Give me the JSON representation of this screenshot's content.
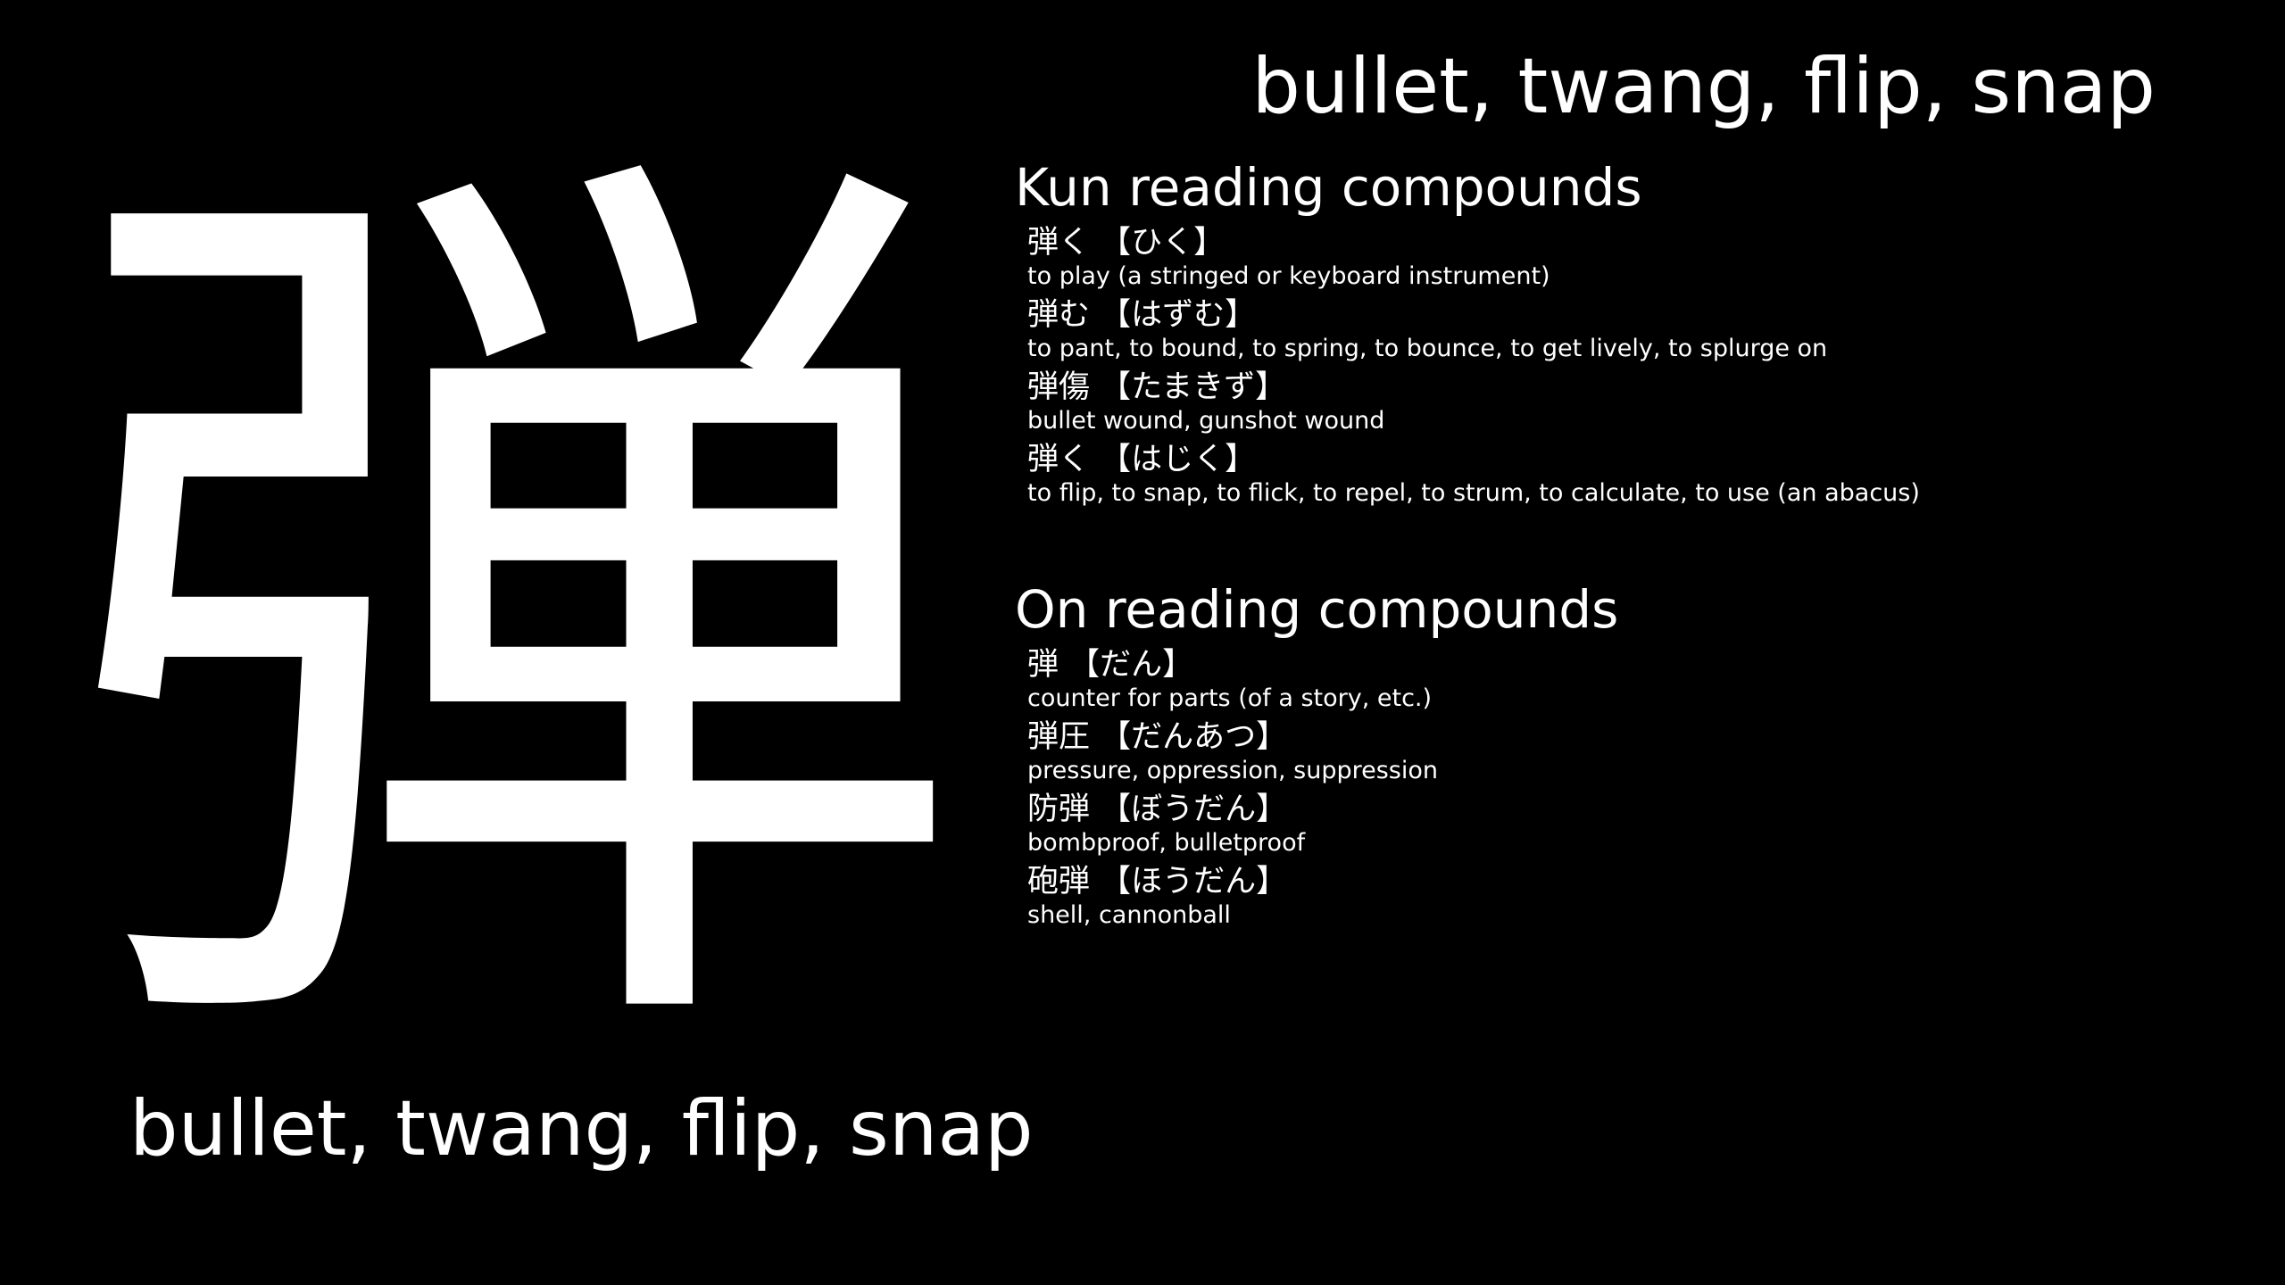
{
  "kanji": "弾",
  "meaning": "bullet, twang, flip, snap",
  "kun": {
    "title": "Kun reading compounds",
    "entries": [
      {
        "word": "弾く 【ひく】",
        "definition": "to play (a stringed or keyboard instrument)"
      },
      {
        "word": "弾む 【はずむ】",
        "definition": "to pant, to bound, to spring, to bounce, to get lively, to splurge on"
      },
      {
        "word": "弾傷 【たまきず】",
        "definition": "bullet wound, gunshot wound"
      },
      {
        "word": "弾く 【はじく】",
        "definition": "to flip, to snap, to flick, to repel, to strum, to calculate, to use (an abacus)"
      }
    ]
  },
  "on": {
    "title": "On reading compounds",
    "entries": [
      {
        "word": "弾 【だん】",
        "definition": "counter for parts (of a story, etc.)"
      },
      {
        "word": "弾圧 【だんあつ】",
        "definition": "pressure, oppression, suppression"
      },
      {
        "word": "防弾 【ぼうだん】",
        "definition": "bombproof, bulletproof"
      },
      {
        "word": "砲弾 【ほうだん】",
        "definition": "shell, cannonball"
      }
    ]
  }
}
